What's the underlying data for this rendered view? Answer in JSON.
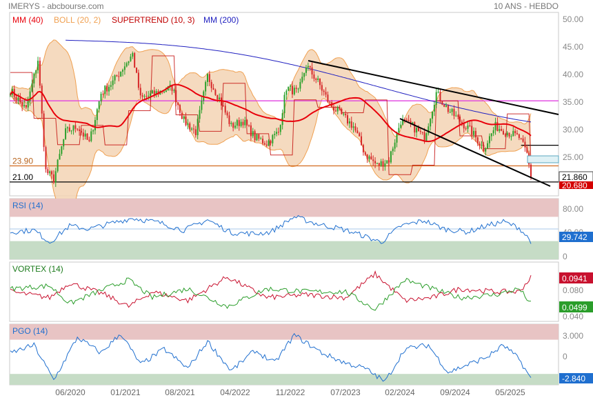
{
  "header": {
    "title": "IMERYS - abcbourse.com",
    "period": "10 ANS - HEBDO"
  },
  "colors": {
    "price_ma40": "#e8000b",
    "boll": "#f0a050",
    "supertrend": "#c00000",
    "ma200": "#2020c0",
    "up": "#2ca02c",
    "down": "#d62728",
    "rsi": "#1f6fcf",
    "vortex_plus": "#2a9d2a",
    "vortex_minus": "#c8102e",
    "pgo": "#1f6fcf"
  },
  "chart_data": [
    {
      "type": "candlestick",
      "legend": [
        {
          "label": "MM (40)",
          "color": "#e8000b"
        },
        {
          "label": "BOLL (20, 2)",
          "color": "#f0a050"
        },
        {
          "label": "SUPERTREND (10, 3)",
          "color": "#c00000"
        },
        {
          "label": "MM (200)",
          "color": "#2020c0"
        }
      ],
      "x_ticks": [
        "06/2020",
        "01/2021",
        "08/2021",
        "04/2022",
        "11/2022",
        "07/2023",
        "02/2024",
        "09/2024",
        "05/2025"
      ],
      "y_ticks": [
        "50.00",
        "45.00",
        "40.00",
        "35.00",
        "30.00",
        "25.00"
      ],
      "ylim": [
        18.5,
        51.5
      ],
      "hlines": [
        {
          "label": "",
          "value": 35.6,
          "color": "#e040e0"
        },
        {
          "label": "23.90",
          "value": 23.9,
          "color": "#d2691e"
        },
        {
          "label": "21.00",
          "value": 21.0,
          "color": "#000000"
        },
        {
          "label": "",
          "value": 27.6,
          "color": "#000000"
        }
      ],
      "last_price": "21.860",
      "last_price_low": "20.680",
      "left_label_overlap": "35.60",
      "anchors": [
        [
          0,
          37.5
        ],
        [
          8,
          34
        ],
        [
          14,
          43
        ],
        [
          18,
          23
        ],
        [
          22,
          21.5
        ],
        [
          28,
          30
        ],
        [
          34,
          31
        ],
        [
          40,
          28
        ],
        [
          46,
          37
        ],
        [
          52,
          39
        ],
        [
          58,
          42
        ],
        [
          62,
          44
        ],
        [
          66,
          36
        ],
        [
          74,
          37
        ],
        [
          82,
          38
        ],
        [
          88,
          32
        ],
        [
          94,
          30
        ],
        [
          100,
          40
        ],
        [
          106,
          36
        ],
        [
          112,
          31
        ],
        [
          118,
          32
        ],
        [
          124,
          29
        ],
        [
          130,
          28
        ],
        [
          136,
          30
        ],
        [
          140,
          38
        ],
        [
          146,
          37
        ],
        [
          150,
          42
        ],
        [
          156,
          39
        ],
        [
          162,
          35
        ],
        [
          168,
          33
        ],
        [
          174,
          31
        ],
        [
          180,
          26
        ],
        [
          186,
          24
        ],
        [
          192,
          25
        ],
        [
          198,
          32
        ],
        [
          204,
          31
        ],
        [
          210,
          29
        ],
        [
          216,
          37
        ],
        [
          222,
          34
        ],
        [
          228,
          32
        ],
        [
          234,
          30
        ],
        [
          240,
          27
        ],
        [
          246,
          31
        ],
        [
          252,
          30
        ],
        [
          258,
          29
        ],
        [
          262,
          26
        ],
        [
          264,
          22
        ]
      ]
    },
    {
      "type": "line",
      "name": "RSI (14)",
      "ylim": [
        0,
        100
      ],
      "y_ticks": [
        "80.00",
        "40.00",
        "0"
      ],
      "zones": [
        {
          "from": 70,
          "to": 100,
          "color": "#e8c4c4"
        },
        {
          "from": 0,
          "to": 30,
          "color": "#c6dcc6"
        }
      ],
      "last_value": "29.742",
      "anchors": [
        [
          0,
          45
        ],
        [
          12,
          48
        ],
        [
          20,
          28
        ],
        [
          30,
          55
        ],
        [
          40,
          50
        ],
        [
          52,
          60
        ],
        [
          62,
          68
        ],
        [
          76,
          60
        ],
        [
          88,
          48
        ],
        [
          100,
          65
        ],
        [
          112,
          44
        ],
        [
          124,
          42
        ],
        [
          132,
          45
        ],
        [
          144,
          70
        ],
        [
          156,
          58
        ],
        [
          168,
          50
        ],
        [
          178,
          40
        ],
        [
          188,
          28
        ],
        [
          198,
          55
        ],
        [
          210,
          64
        ],
        [
          220,
          50
        ],
        [
          232,
          45
        ],
        [
          240,
          54
        ],
        [
          250,
          62
        ],
        [
          258,
          52
        ],
        [
          264,
          30
        ]
      ]
    },
    {
      "type": "line",
      "name": "VORTEX (14)",
      "ylim": [
        0.02,
        0.12
      ],
      "y_ticks": [
        "0.080",
        "0.040"
      ],
      "series": [
        {
          "name": "",
          "color": "#c8102e",
          "last_value": "0.0941",
          "anchors": [
            [
              0,
              0.07
            ],
            [
              20,
              0.06
            ],
            [
              30,
              0.085
            ],
            [
              48,
              0.065
            ],
            [
              60,
              0.045
            ],
            [
              72,
              0.07
            ],
            [
              90,
              0.055
            ],
            [
              110,
              0.095
            ],
            [
              130,
              0.06
            ],
            [
              150,
              0.065
            ],
            [
              170,
              0.06
            ],
            [
              185,
              0.1
            ],
            [
              200,
              0.055
            ],
            [
              214,
              0.06
            ],
            [
              228,
              0.075
            ],
            [
              246,
              0.07
            ],
            [
              258,
              0.07
            ],
            [
              264,
              0.094
            ]
          ]
        },
        {
          "name": "",
          "color": "#2a9d2a",
          "last_value": "0.0499",
          "anchors": [
            [
              0,
              0.075
            ],
            [
              20,
              0.08
            ],
            [
              30,
              0.05
            ],
            [
              48,
              0.075
            ],
            [
              60,
              0.09
            ],
            [
              72,
              0.06
            ],
            [
              90,
              0.075
            ],
            [
              110,
              0.045
            ],
            [
              130,
              0.075
            ],
            [
              150,
              0.07
            ],
            [
              170,
              0.07
            ],
            [
              185,
              0.04
            ],
            [
              200,
              0.09
            ],
            [
              214,
              0.075
            ],
            [
              228,
              0.06
            ],
            [
              246,
              0.065
            ],
            [
              258,
              0.075
            ],
            [
              264,
              0.05
            ]
          ]
        }
      ]
    },
    {
      "type": "line",
      "name": "PGO (14)",
      "ylim": [
        -3.6,
        4.2
      ],
      "y_ticks": [
        "3.000",
        "0"
      ],
      "zones": [
        {
          "from": 2.2,
          "to": 4.2,
          "color": "#e8c4c4"
        },
        {
          "from": -3.6,
          "to": -2.2,
          "color": "#c6dcc6"
        }
      ],
      "last_value": "-2.840",
      "anchors": [
        [
          0,
          0.5
        ],
        [
          12,
          1.5
        ],
        [
          22,
          -3.0
        ],
        [
          34,
          2.5
        ],
        [
          46,
          0.5
        ],
        [
          56,
          3.0
        ],
        [
          66,
          -1.0
        ],
        [
          78,
          1.0
        ],
        [
          90,
          -1.5
        ],
        [
          100,
          2.0
        ],
        [
          112,
          -1.8
        ],
        [
          124,
          0.8
        ],
        [
          134,
          -0.8
        ],
        [
          144,
          2.8
        ],
        [
          158,
          0.5
        ],
        [
          170,
          -0.8
        ],
        [
          180,
          -1.5
        ],
        [
          190,
          -3.2
        ],
        [
          200,
          1.0
        ],
        [
          212,
          1.5
        ],
        [
          222,
          -2.0
        ],
        [
          232,
          -1.0
        ],
        [
          242,
          0.0
        ],
        [
          250,
          1.5
        ],
        [
          258,
          -0.3
        ],
        [
          264,
          -2.84
        ]
      ]
    }
  ]
}
